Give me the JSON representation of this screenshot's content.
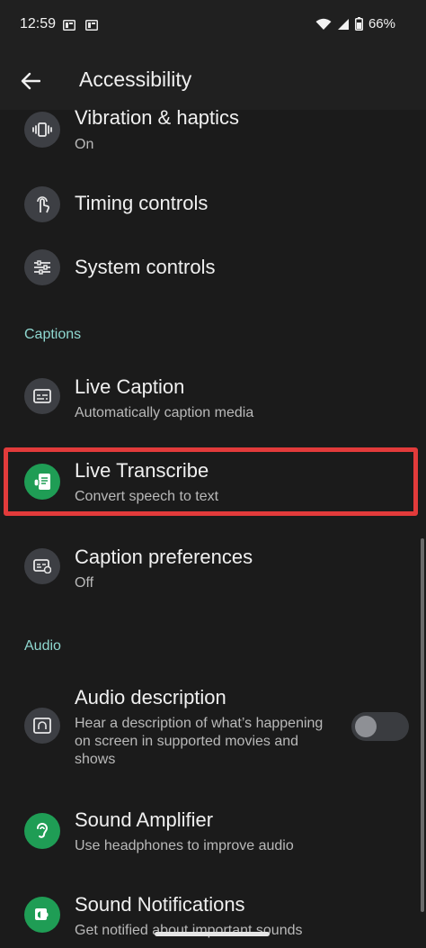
{
  "status_bar": {
    "time": "12:59",
    "battery_percent": "66%",
    "icons": [
      "sim-card-icon",
      "sim-card-icon",
      "wifi-icon",
      "signal-icon",
      "battery-icon"
    ]
  },
  "app_bar": {
    "back_icon": "arrow-left-icon",
    "title": "Accessibility"
  },
  "items": {
    "vibration": {
      "title": "Vibration & haptics",
      "subtitle": "On",
      "icon": "vibration-icon"
    },
    "timing": {
      "title": "Timing controls",
      "icon": "touch-timer-icon"
    },
    "system": {
      "title": "System controls",
      "icon": "sliders-icon"
    },
    "live_caption": {
      "title": "Live Caption",
      "subtitle": "Automatically caption media",
      "icon": "caption-icon"
    },
    "live_transcribe": {
      "title": "Live Transcribe",
      "subtitle": "Convert speech to text",
      "icon": "transcribe-icon"
    },
    "caption_prefs": {
      "title": "Caption preferences",
      "subtitle": "Off",
      "icon": "caption-settings-icon"
    },
    "audio_description": {
      "title": "Audio description",
      "subtitle_lines": [
        "Hear a description of what’s happening",
        "on screen in supported movies and",
        "shows"
      ],
      "icon": "audio-description-icon",
      "toggle_on": false
    },
    "sound_amplifier": {
      "title": "Sound Amplifier",
      "subtitle": "Use headphones to improve audio",
      "icon": "ear-icon"
    },
    "sound_notifications": {
      "title": "Sound Notifications",
      "subtitle": "Get notified about important sounds",
      "icon": "sound-notification-icon"
    }
  },
  "sections": {
    "captions": "Captions",
    "audio": "Audio"
  },
  "colors": {
    "background": "#1b1b1b",
    "section_header": "#8fd8d0",
    "highlight": "#e23b3b",
    "green_icon": "#1f9d55"
  }
}
